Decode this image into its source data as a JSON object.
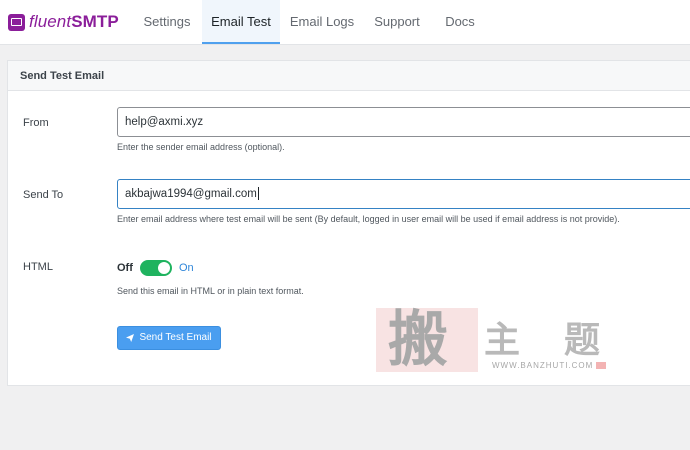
{
  "header": {
    "logo": {
      "part1": "fluent",
      "part2": "SMTP"
    },
    "tabs": [
      {
        "label": "Settings",
        "active": false
      },
      {
        "label": "Email Test",
        "active": true
      },
      {
        "label": "Email Logs",
        "active": false
      },
      {
        "label": "Support",
        "active": false
      },
      {
        "label": "Docs",
        "active": false
      }
    ]
  },
  "panel": {
    "title": "Send Test Email",
    "from": {
      "label": "From",
      "value": "help@axmi.xyz",
      "help": "Enter the sender email address (optional)."
    },
    "send_to": {
      "label": "Send To",
      "value": "akbajwa1994@gmail.com",
      "help": "Enter email address where test email will be sent (By default, logged in user email will be used if email address is not provide)."
    },
    "html": {
      "label": "HTML",
      "off_label": "Off",
      "on_label": "On",
      "enabled": true,
      "help": "Send this email in HTML or in plain text format."
    },
    "send_button": "Send Test Email"
  },
  "watermark": {
    "big_char": "搬",
    "chars": [
      "主",
      "题"
    ],
    "url": "WWW.BANZHUTI.COM"
  },
  "colors": {
    "brand": "#8b1e9a",
    "toggle_on": "#1fb35f",
    "button": "#4a9ef0",
    "active_tab_bg": "#f0f6fc"
  }
}
